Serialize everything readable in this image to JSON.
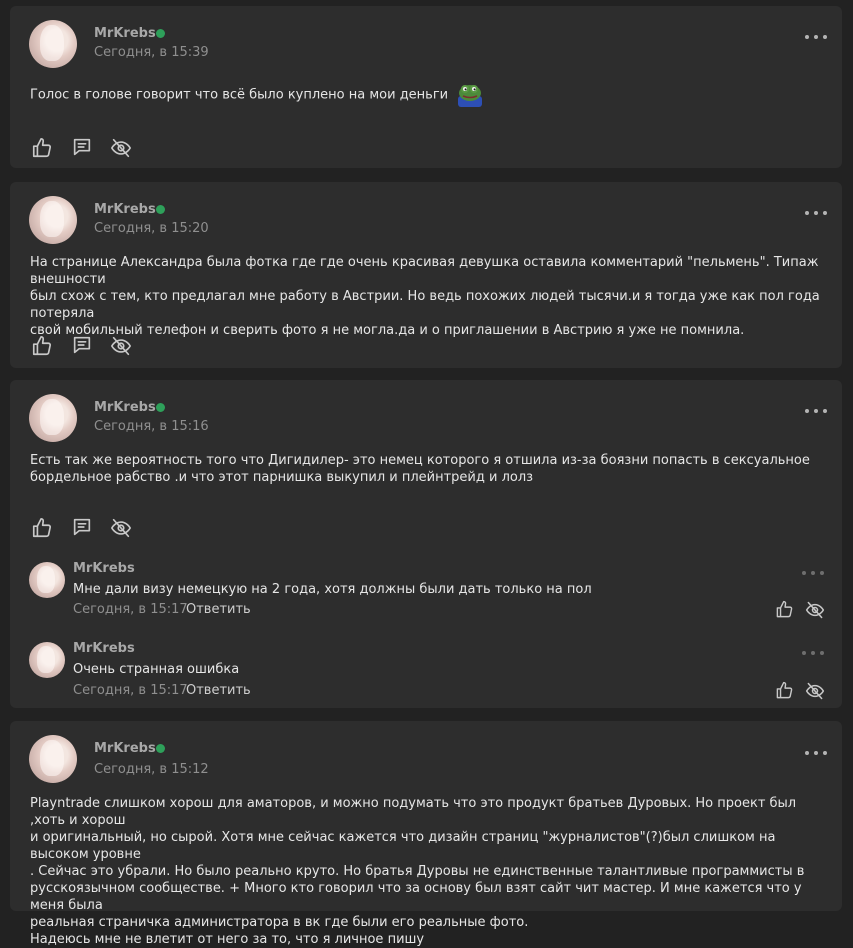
{
  "posts": [
    {
      "author": "MrKrebs",
      "time": "Сегодня, в 15:39",
      "text": "Голос в голове говорит что всё было куплено на мои деньги",
      "emoji": "pepe-frog-emoji"
    },
    {
      "author": "MrKrebs",
      "time": "Сегодня, в 15:20",
      "lines": [
        "На странице Александра была фотка где где очень красивая девушка оставила комментарий \"пельмень\". Типаж внешности",
        "был схож с тем, кто предлагал мне работу в Австрии. Но ведь похожих людей тысячи.и я тогда уже как пол года потеряла",
        "свой мобильный телефон и сверить фото я не могла.да и о приглашении в Австрию я уже не помнила."
      ]
    },
    {
      "author": "MrKrebs",
      "time": "Сегодня, в 15:16",
      "lines": [
        "Есть так же вероятность того что Дигидилер- это немец которого я отшила из-за боязни попасть в сексуальное",
        "бордельное рабство .и что этот парнишка выкупил и плейнтрейд и лолз"
      ],
      "replies": [
        {
          "author": "MrKrebs",
          "text": "Мне дали визу немецкую на 2 года, хотя должны были дать только на пол",
          "time": "Сегодня, в 15:17",
          "reply_label": "Ответить"
        },
        {
          "author": "MrKrebs",
          "text": "Очень странная ошибка",
          "time": "Сегодня, в 15:17",
          "reply_label": "Ответить"
        }
      ]
    },
    {
      "author": "MrKrebs",
      "time": "Сегодня, в 15:12",
      "lines": [
        "Playntrade слишком хорош для аматоров, и можно подумать что это продукт братьев Дуровых. Но проект был ,хоть и хорош",
        "и оригинальный, но сырой. Хотя мне сейчас кажется что дизайн страниц \"журналистов\"(?)был слишком на высоком уровне",
        ". Сейчас это убрали. Но было реально круто. Но братья Дуровы не единственные талантливые программисты в",
        "русскоязычном сообществе. + Много кто говорил что за основу был взят сайт чит мастер. И мне кажется что у меня была",
        "реальная страничка администратора в вк где были его реальные фото.",
        "Надеюсь мне не влетит от него за то, что я личное пишу"
      ]
    }
  ],
  "icons": {
    "like": "thumbs-up-icon",
    "comment": "comment-icon",
    "hide": "eye-off-icon",
    "menu": "more-dots-icon"
  },
  "colors": {
    "background": "#222222",
    "card": "#2d2d2d",
    "online": "#2ea05a",
    "text": "#e6e6e6",
    "muted": "#8f8f8f"
  }
}
